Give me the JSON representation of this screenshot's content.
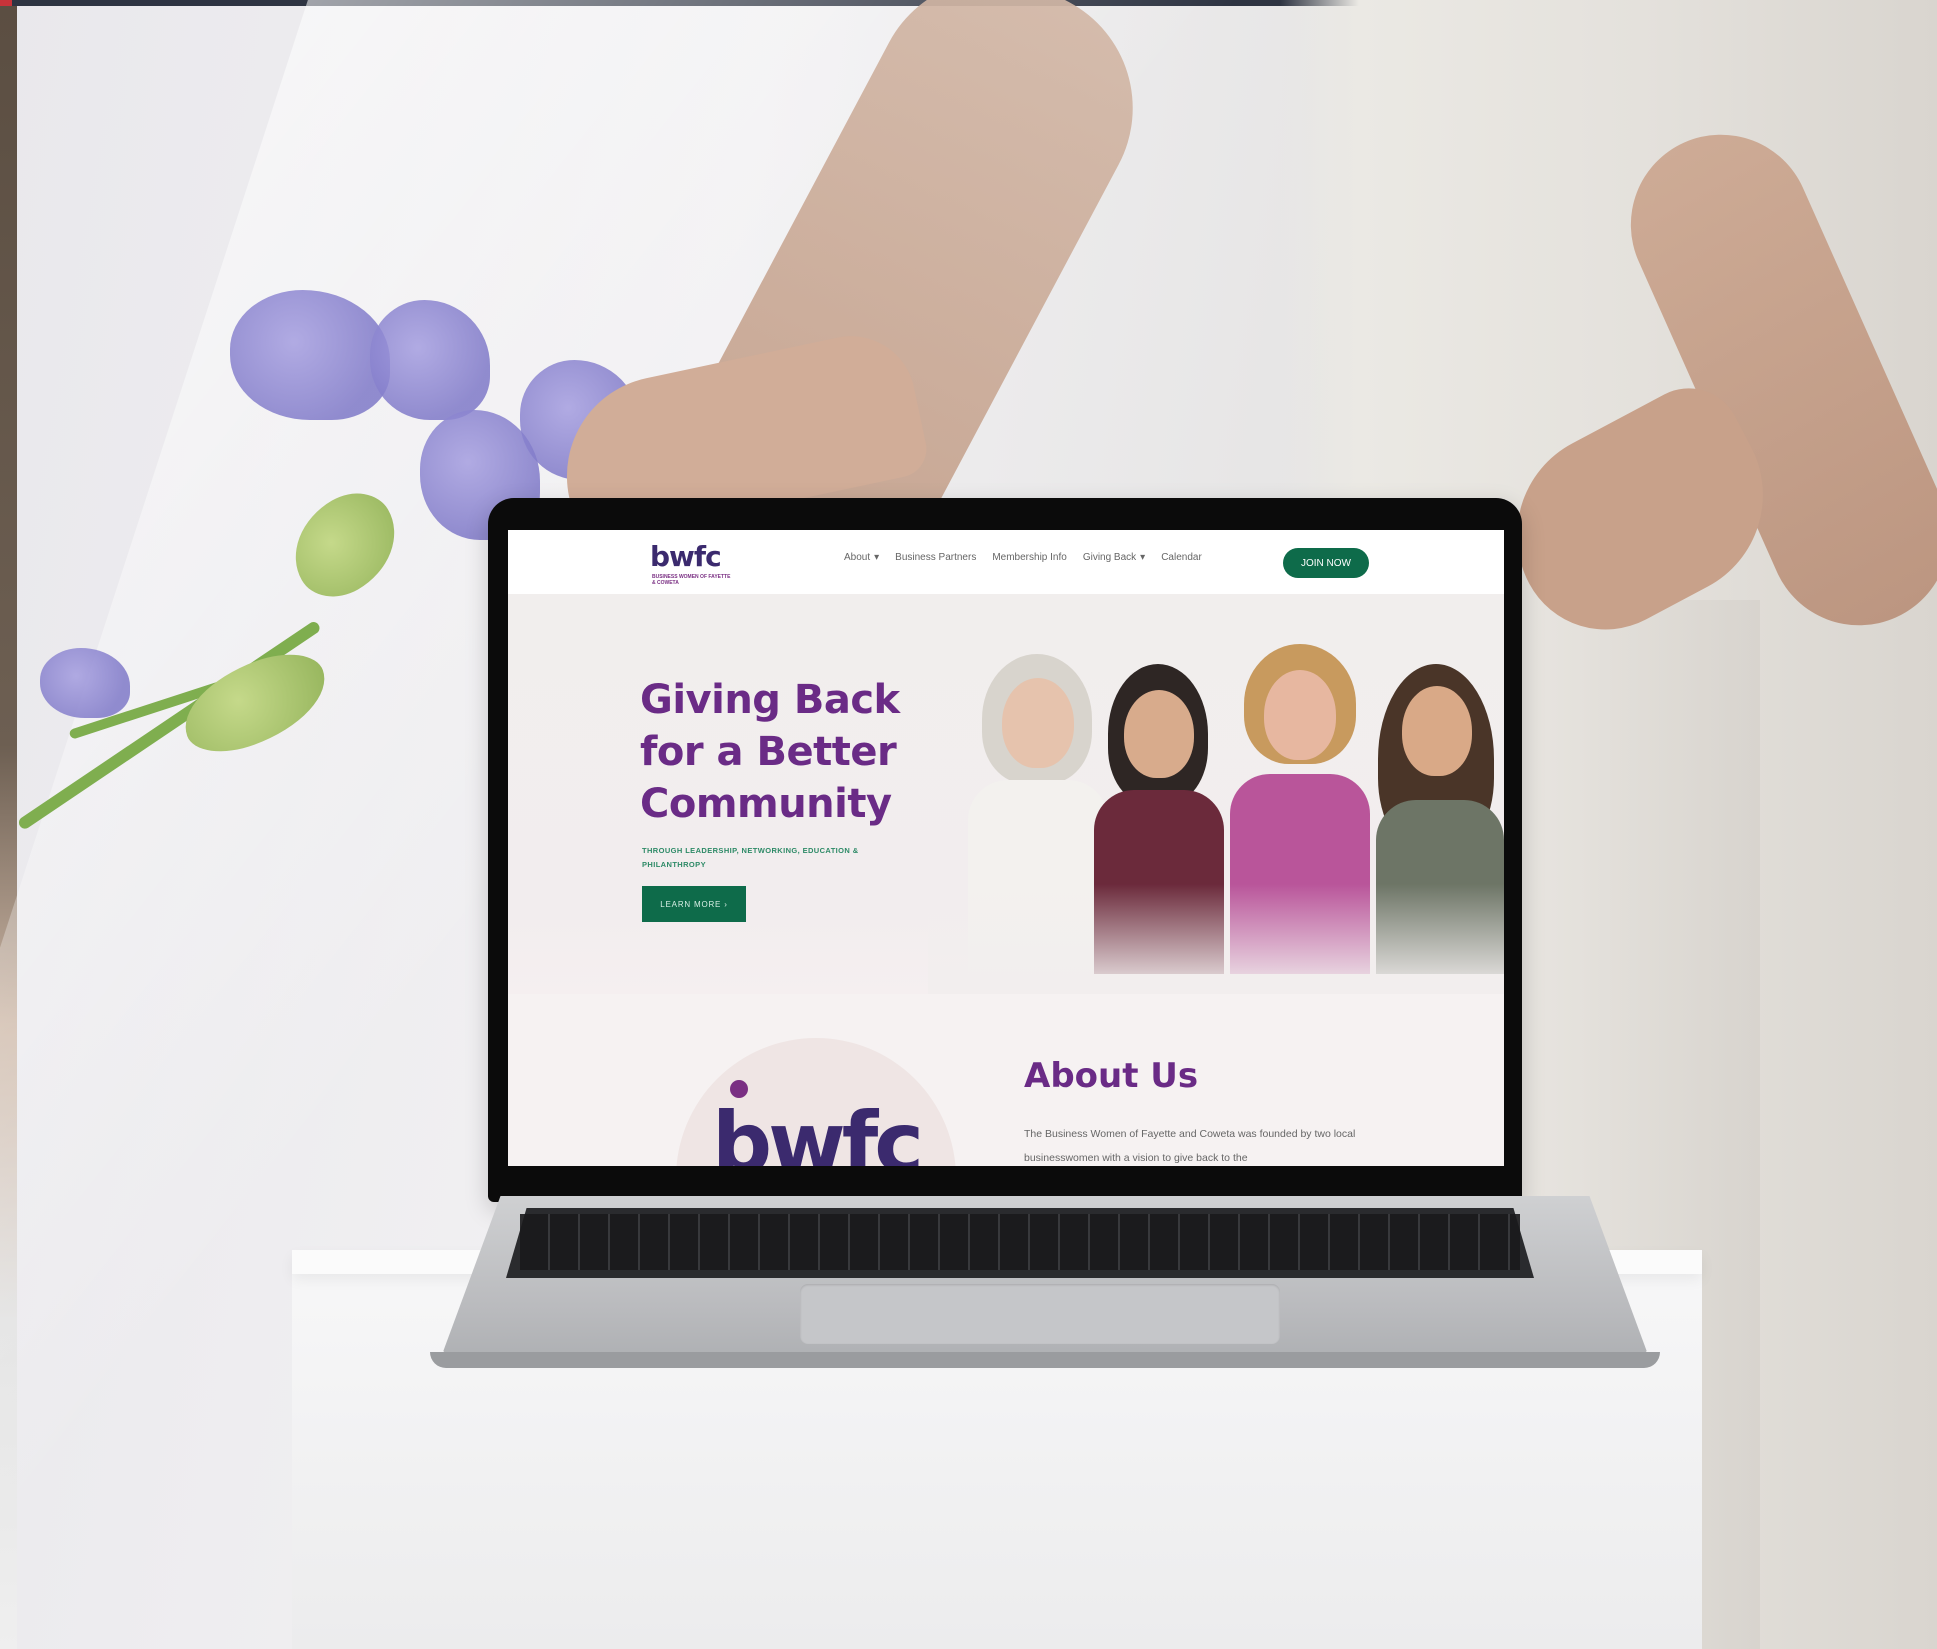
{
  "site": {
    "logo": {
      "mark": "bwfc",
      "tagline": "BUSINESS WOMEN OF FAYETTE & COWETA"
    },
    "nav": [
      {
        "label": "About",
        "has_dropdown": true
      },
      {
        "label": "Business Partners",
        "has_dropdown": false
      },
      {
        "label": "Membership Info",
        "has_dropdown": false
      },
      {
        "label": "Giving Back",
        "has_dropdown": true
      },
      {
        "label": "Calendar",
        "has_dropdown": false
      }
    ],
    "cta": "JOIN NOW",
    "hero": {
      "title": "Giving Back for a Better Community",
      "subtitle": "THROUGH LEADERSHIP, NETWORKING, EDUCATION & PHILANTHROPY",
      "button": "LEARN MORE ›"
    },
    "about": {
      "title": "About Us",
      "logo_mark": "bwfc",
      "text": "The Business Women of Fayette and Coweta was founded by two local businesswomen with a vision to give back to the"
    }
  },
  "colors": {
    "brand_purple": "#6a2b86",
    "brand_green": "#0e6b4a",
    "logo_navy": "#3b2a6e"
  },
  "icons": {
    "dropdown": "chevron-down-icon"
  }
}
